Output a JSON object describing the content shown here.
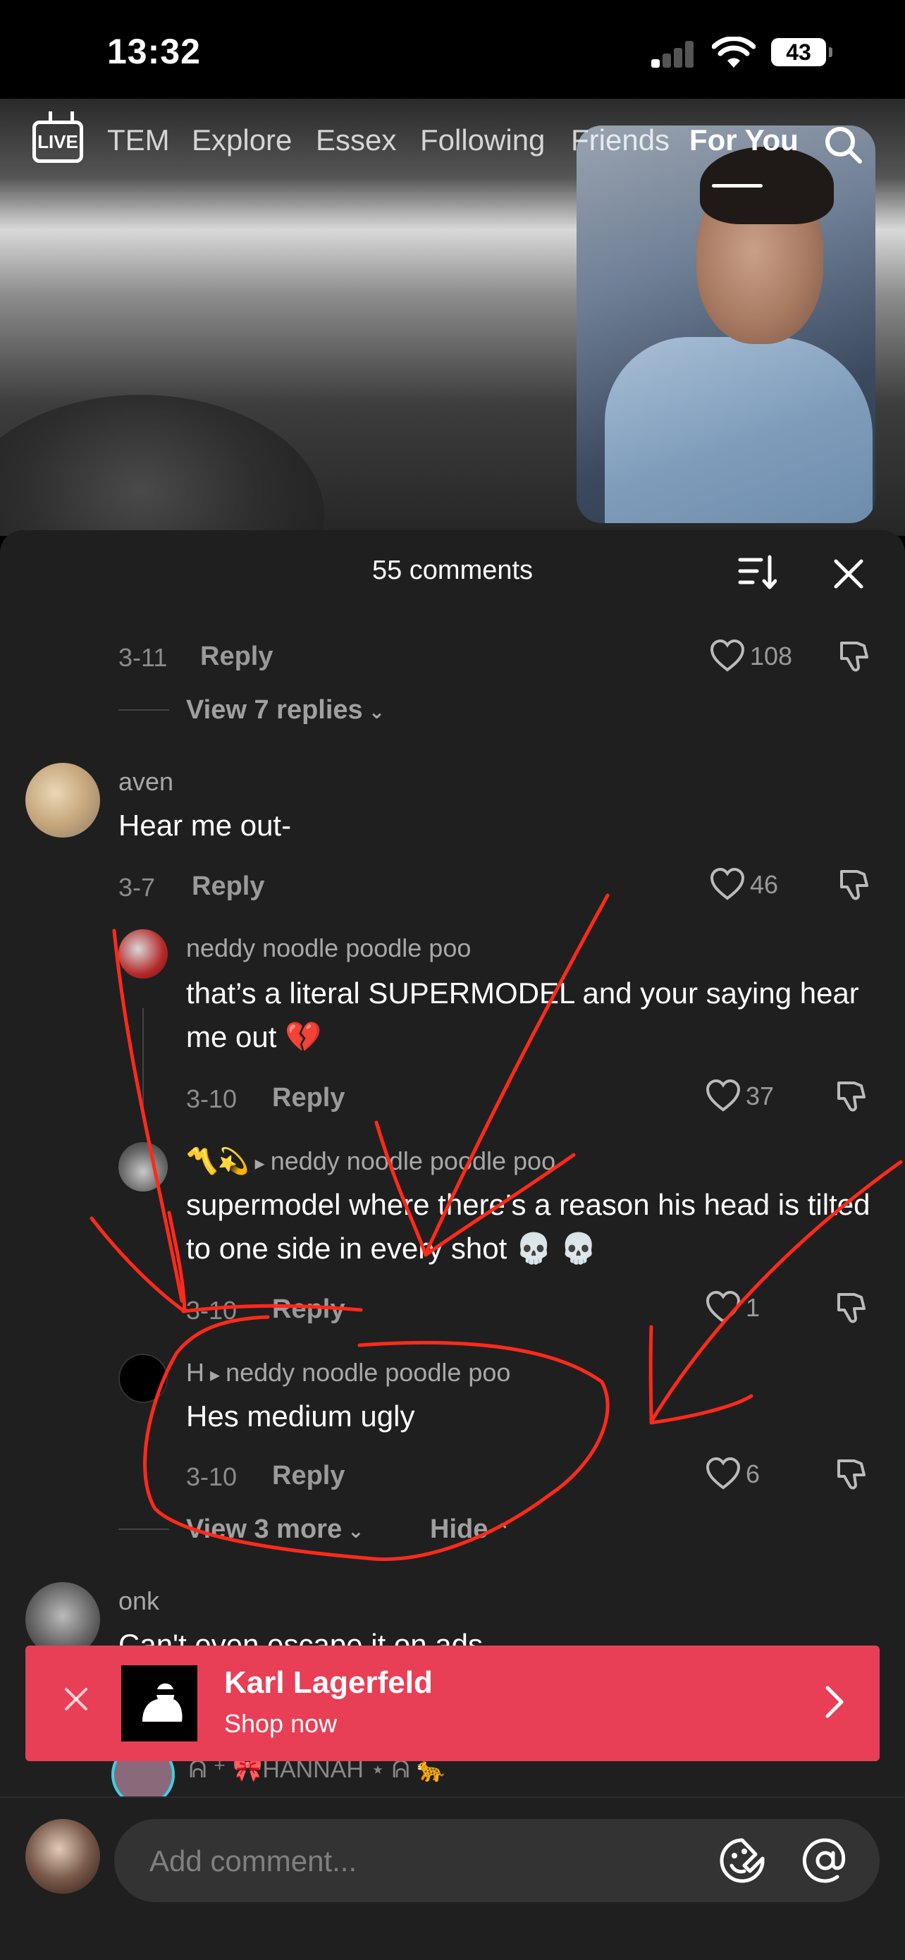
{
  "status_bar": {
    "time": "13:32",
    "battery": "43"
  },
  "top_nav": {
    "live_label": "LIVE",
    "tabs": [
      {
        "label": "TEM"
      },
      {
        "label": "Explore"
      },
      {
        "label": "Essex"
      },
      {
        "label": "Following"
      },
      {
        "label": "Friends"
      },
      {
        "label": "For You",
        "active": true
      }
    ]
  },
  "comments_panel": {
    "title": "55 comments",
    "first_comment_footer": {
      "time": "3-11",
      "reply": "Reply",
      "likes": "108",
      "view_replies": "View 7 replies"
    },
    "comments": [
      {
        "user": "aven",
        "text": "Hear me out-",
        "time": "3-7",
        "reply": "Reply",
        "likes": "46",
        "replies": [
          {
            "user": "neddy noodle poodle poo",
            "text": "that’s a literal SUPERMODEL and your saying hear me out 💔",
            "time": "3-10",
            "reply": "Reply",
            "likes": "37"
          },
          {
            "user": "〽️💫",
            "reply_to": "neddy noodle poodle poo",
            "text": "supermodel where there’s a reason his head is tilted to one side in every shot 💀 💀",
            "time": "3-10",
            "reply": "Reply",
            "likes": "1"
          },
          {
            "user": "H",
            "reply_to": "neddy noodle poodle poo",
            "text": "Hes medium ugly",
            "time": "3-10",
            "reply": "Reply",
            "likes": "6"
          }
        ],
        "view_more": "View 3 more",
        "hide": "Hide"
      },
      {
        "user": "onk",
        "text": "Can't even escape it on ads"
      }
    ],
    "partial_user": "ᕱ ⁺ 🎀HANNAH ⋆ ᕱ 🐆"
  },
  "ad": {
    "brand": "Karl Lagerfeld",
    "cta": "Shop now"
  },
  "input": {
    "placeholder": "Add comment..."
  },
  "colors": {
    "panel_bg": "#1f1f1f",
    "ad_bg": "#e83f56",
    "annotation": "#ff2a1a"
  },
  "icons": [
    "live-icon",
    "search-icon",
    "sort-icon",
    "close-icon",
    "heart-icon",
    "dislike-icon",
    "chevron-down-icon",
    "chevron-up-icon",
    "chevron-right-icon",
    "emoji-icon",
    "at-icon"
  ]
}
